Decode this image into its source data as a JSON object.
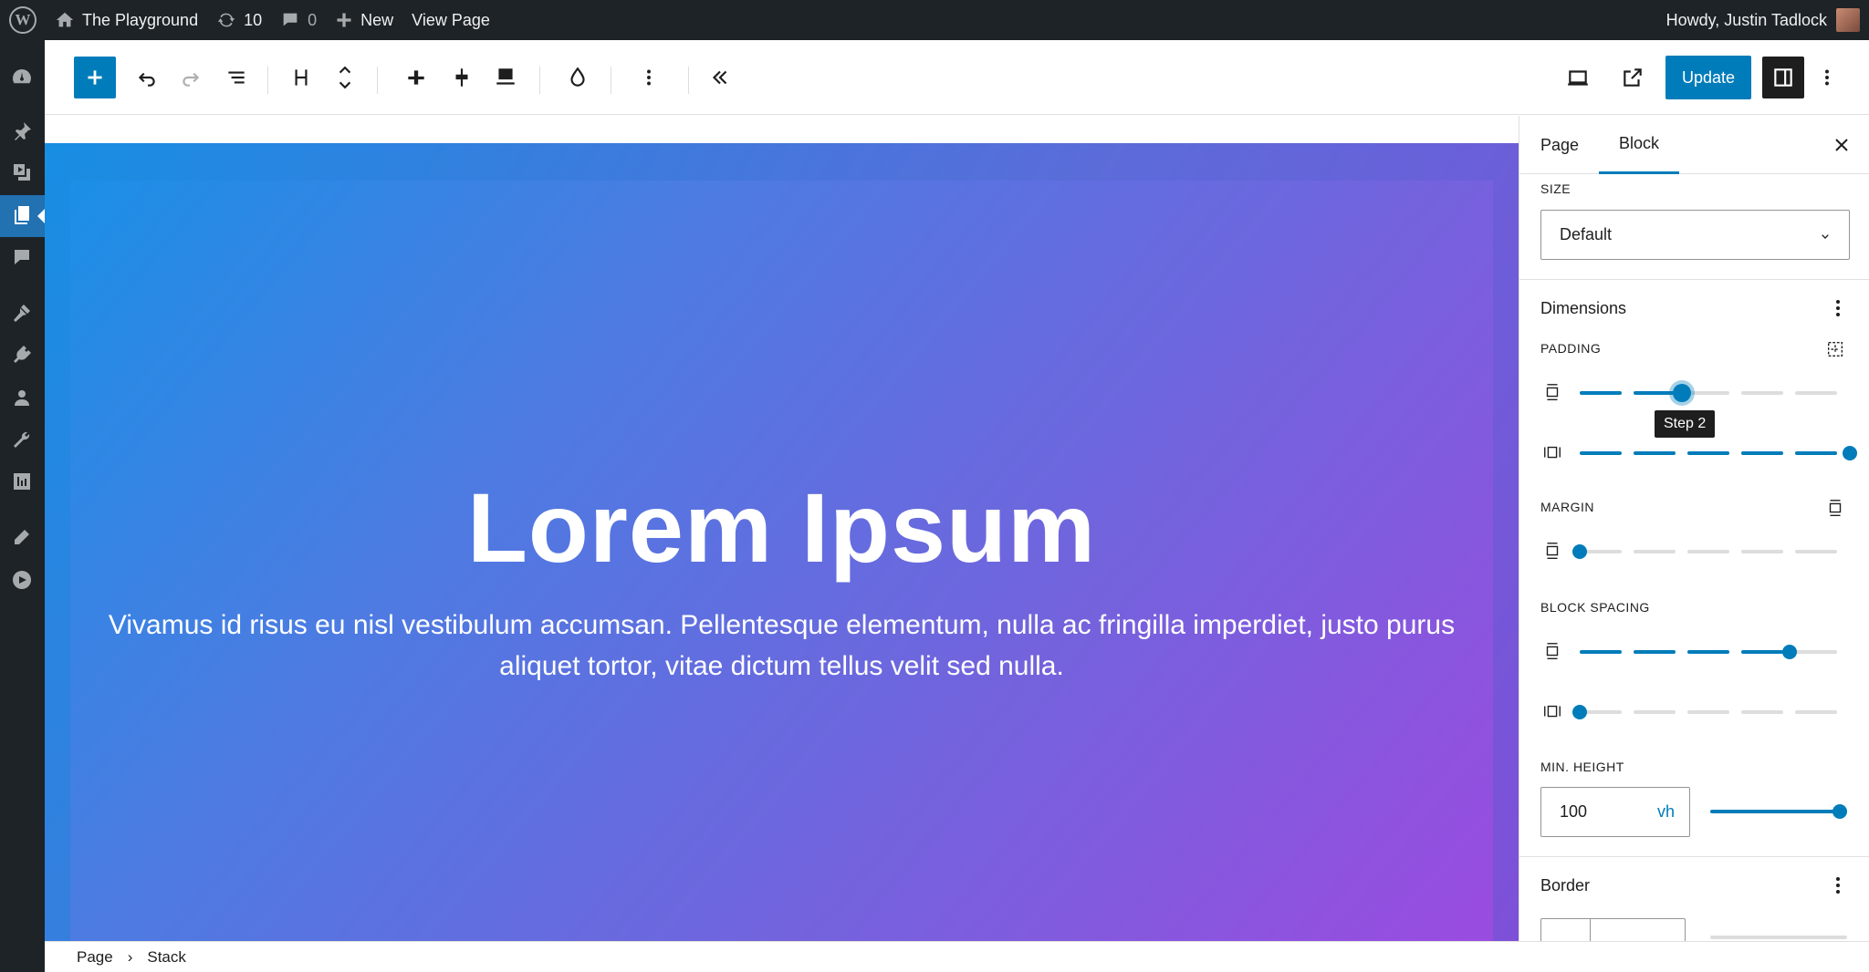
{
  "adminbar": {
    "site_name": "The Playground",
    "updates_count": "10",
    "comments_count": "0",
    "new_label": "New",
    "view_label": "View Page",
    "greeting": "Howdy, Justin Tadlock"
  },
  "header": {
    "update_label": "Update"
  },
  "canvas": {
    "title": "Lorem Ipsum",
    "text": "Vivamus id risus eu nisl vestibulum accumsan. Pellentesque elementum, nulla ac fringilla imperdiet, justo purus aliquet tortor, vitae dictum tellus velit sed nulla."
  },
  "footer": {
    "crumb_page": "Page",
    "separator": "›",
    "crumb_block": "Stack"
  },
  "sidebar": {
    "tab_page": "Page",
    "tab_block": "Block",
    "size_label": "SIZE",
    "size_value": "Default",
    "dimensions_heading": "Dimensions",
    "padding_label": "PADDING",
    "tooltip": "Step 2",
    "margin_label": "MARGIN",
    "block_spacing_label": "BLOCK SPACING",
    "min_height_label": "MIN. HEIGHT",
    "min_height_value": "100",
    "min_height_unit": "vh",
    "border_heading": "Border"
  },
  "controls": {
    "padding_vertical_step": 2,
    "padding_horizontal_step": 5,
    "margin_step": 0,
    "block_spacing_vertical_step": 4,
    "block_spacing_horizontal_step": 0,
    "step_count": 5,
    "min_height_level": 1.0
  },
  "colors": {
    "accent": "#007cba",
    "admin_bg": "#1d2327",
    "cover_gradient_start": "#1b8fe6",
    "cover_gradient_end": "#9b4be0"
  }
}
